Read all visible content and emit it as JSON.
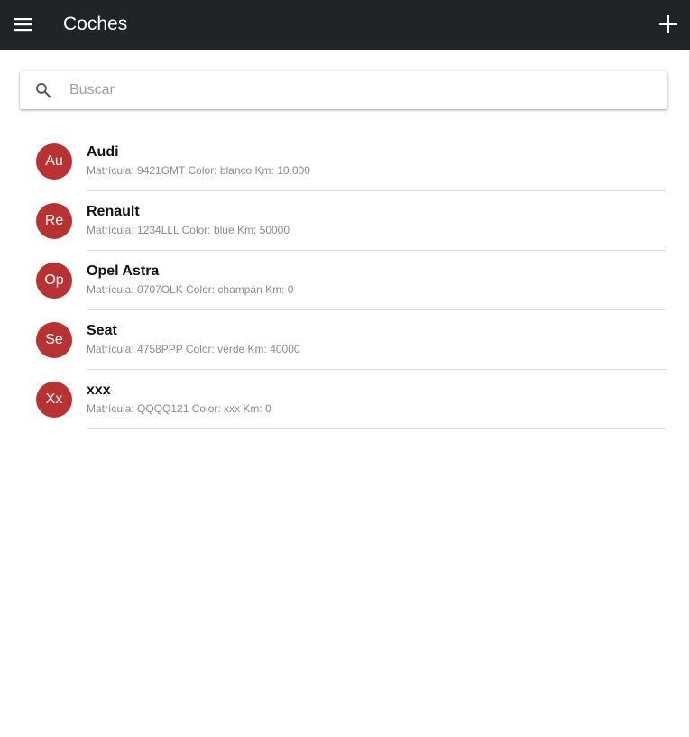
{
  "appbar": {
    "title": "Coches",
    "menu_icon": "menu-icon",
    "add_icon": "plus-icon",
    "background": "#222326"
  },
  "search": {
    "placeholder": "Buscar",
    "value": "",
    "icon": "search-icon"
  },
  "accent_color": "#b83232",
  "cars": [
    {
      "initials": "Au",
      "name": "Audi",
      "details": "Matrícula: 9421GMT Color: blanco Km: 10.000"
    },
    {
      "initials": "Re",
      "name": "Renault",
      "details": "Matrícula: 1234LLL Color: blue Km: 50000"
    },
    {
      "initials": "Op",
      "name": "Opel Astra",
      "details": "Matrícula: 0707OLK Color: champán Km: 0"
    },
    {
      "initials": "Se",
      "name": "Seat",
      "details": "Matrícula: 4758PPP Color: verde Km: 40000"
    },
    {
      "initials": "Xx",
      "name": "xxx",
      "details": "Matrícula: QQQQ121 Color: xxx Km: 0"
    }
  ]
}
